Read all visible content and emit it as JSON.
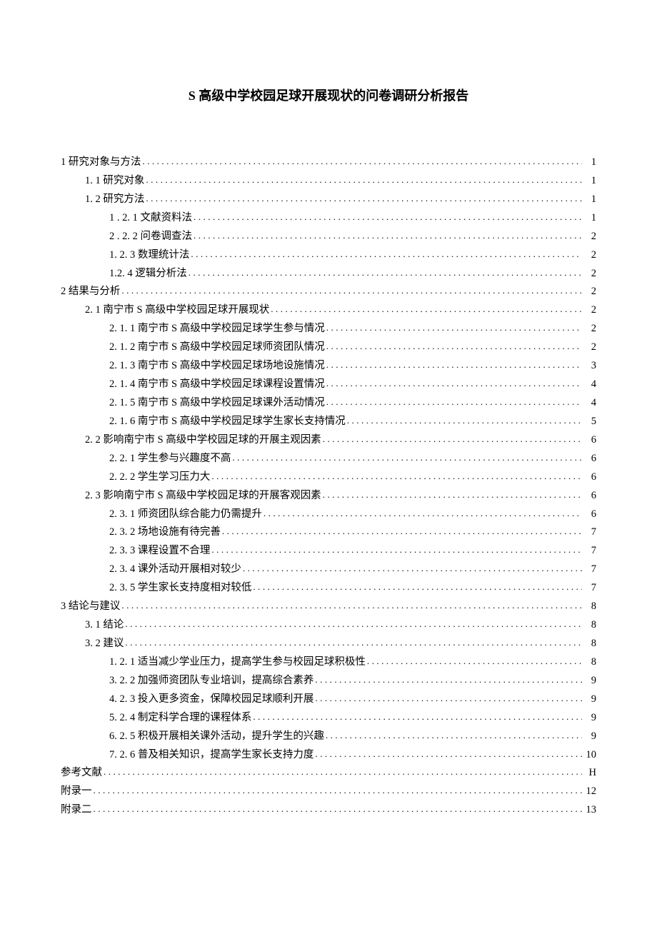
{
  "title": "S 高级中学校园足球开展现状的问卷调研分析报告",
  "toc": [
    {
      "level": 1,
      "label": "1 研究对象与方法",
      "page": "1"
    },
    {
      "level": 2,
      "label": "1. 1 研究对象",
      "page": "1"
    },
    {
      "level": 2,
      "label": "1. 2 研究方法",
      "page": "1"
    },
    {
      "level": 3,
      "label": "1 . 2. 1 文献资料法 ",
      "page": "1"
    },
    {
      "level": 3,
      "label": "2 . 2. 2 问卷调查法 ",
      "page": "2"
    },
    {
      "level": 3,
      "label": "1.  2. 3 数理统计法",
      "page": "2"
    },
    {
      "level": 3,
      "label": "1.2. 4 逻辑分析法",
      "page": "2"
    },
    {
      "level": 1,
      "label": "2 结果与分析",
      "page": "2"
    },
    {
      "level": 2,
      "label": "2. 1  南宁市 S 高级中学校园足球开展现状",
      "page": "2"
    },
    {
      "level": 3,
      "label": "2.  1. 1 南宁市 S 高级中学校园足球学生参与情况 ",
      "page": "2"
    },
    {
      "level": 3,
      "label": "2.  1. 2 南宁市 S 高级中学校园足球师资团队情况 ",
      "page": "2"
    },
    {
      "level": 3,
      "label": "2.  1. 3 南宁市 S 高级中学校园足球场地设施情况 ",
      "page": "3"
    },
    {
      "level": 3,
      "label": "2. 1.  4 南宁市 S 高级中学校园足球课程设置情况 ",
      "page": "4"
    },
    {
      "level": 3,
      "label": "2.  1. 5 南宁市 S 高级中学校园足球课外活动情况 ",
      "page": "4"
    },
    {
      "level": 3,
      "label": "2. 1.  6 南宁市 S 高级中学校园足球学生家长支持情况 ",
      "page": "5"
    },
    {
      "level": 2,
      "label": "2.  2 影响南宁市 S 高级中学校园足球的开展主观因素 ",
      "page": "6"
    },
    {
      "level": 3,
      "label": "2.  2. 1 学生参与兴趣度不高",
      "page": "6"
    },
    {
      "level": 3,
      "label": "2.  2. 2 学生学习压力大",
      "page": "6"
    },
    {
      "level": 2,
      "label": "2.  3 影响南宁市 S 高级中学校园足球的开展客观因素 ",
      "page": "6"
    },
    {
      "level": 3,
      "label": "2.  3. 1 师资团队综合能力仍需提升",
      "page": "6"
    },
    {
      "level": 3,
      "label": "2.  3. 2 场地设施有待完善",
      "page": "7"
    },
    {
      "level": 3,
      "label": "2.  3. 3 课程设置不合理",
      "page": "7"
    },
    {
      "level": 3,
      "label": "2.  3. 4 课外活动开展相对较少",
      "page": "7"
    },
    {
      "level": 3,
      "label": "2.  3. 5 学生家长支持度相对较低",
      "page": "7"
    },
    {
      "level": 1,
      "label": "3 结论与建议",
      "page": "8"
    },
    {
      "level": 2,
      "label": "3.  1 结论",
      "page": "8"
    },
    {
      "level": 2,
      "label": "3.  2 建议",
      "page": "8"
    },
    {
      "level": 3,
      "label": "1.  2. 1 适当减少学业压力，提高学生参与校园足球积极性",
      "page": "8"
    },
    {
      "level": 3,
      "label": "3.  2. 2 加强师资团队专业培训，提高综合素养",
      "page": "9"
    },
    {
      "level": 3,
      "label": "4.  2. 3 投入更多资金，保障校园足球顺利开展",
      "page": "9"
    },
    {
      "level": 3,
      "label": "5.  2. 4 制定科学合理的课程体系",
      "page": "9"
    },
    {
      "level": 3,
      "label": "6.  2. 5 积极开展相关课外活动，提升学生的兴趣",
      "page": "9"
    },
    {
      "level": 3,
      "label": "7.  2. 6 普及相关知识，提高学生家长支持力度",
      "page": "10"
    },
    {
      "level": 1,
      "label": "参考文献 ",
      "page": "H"
    },
    {
      "level": 1,
      "label": "附录一 ",
      "page": "12"
    },
    {
      "level": 1,
      "label": "附录二 ",
      "page": "13"
    }
  ]
}
